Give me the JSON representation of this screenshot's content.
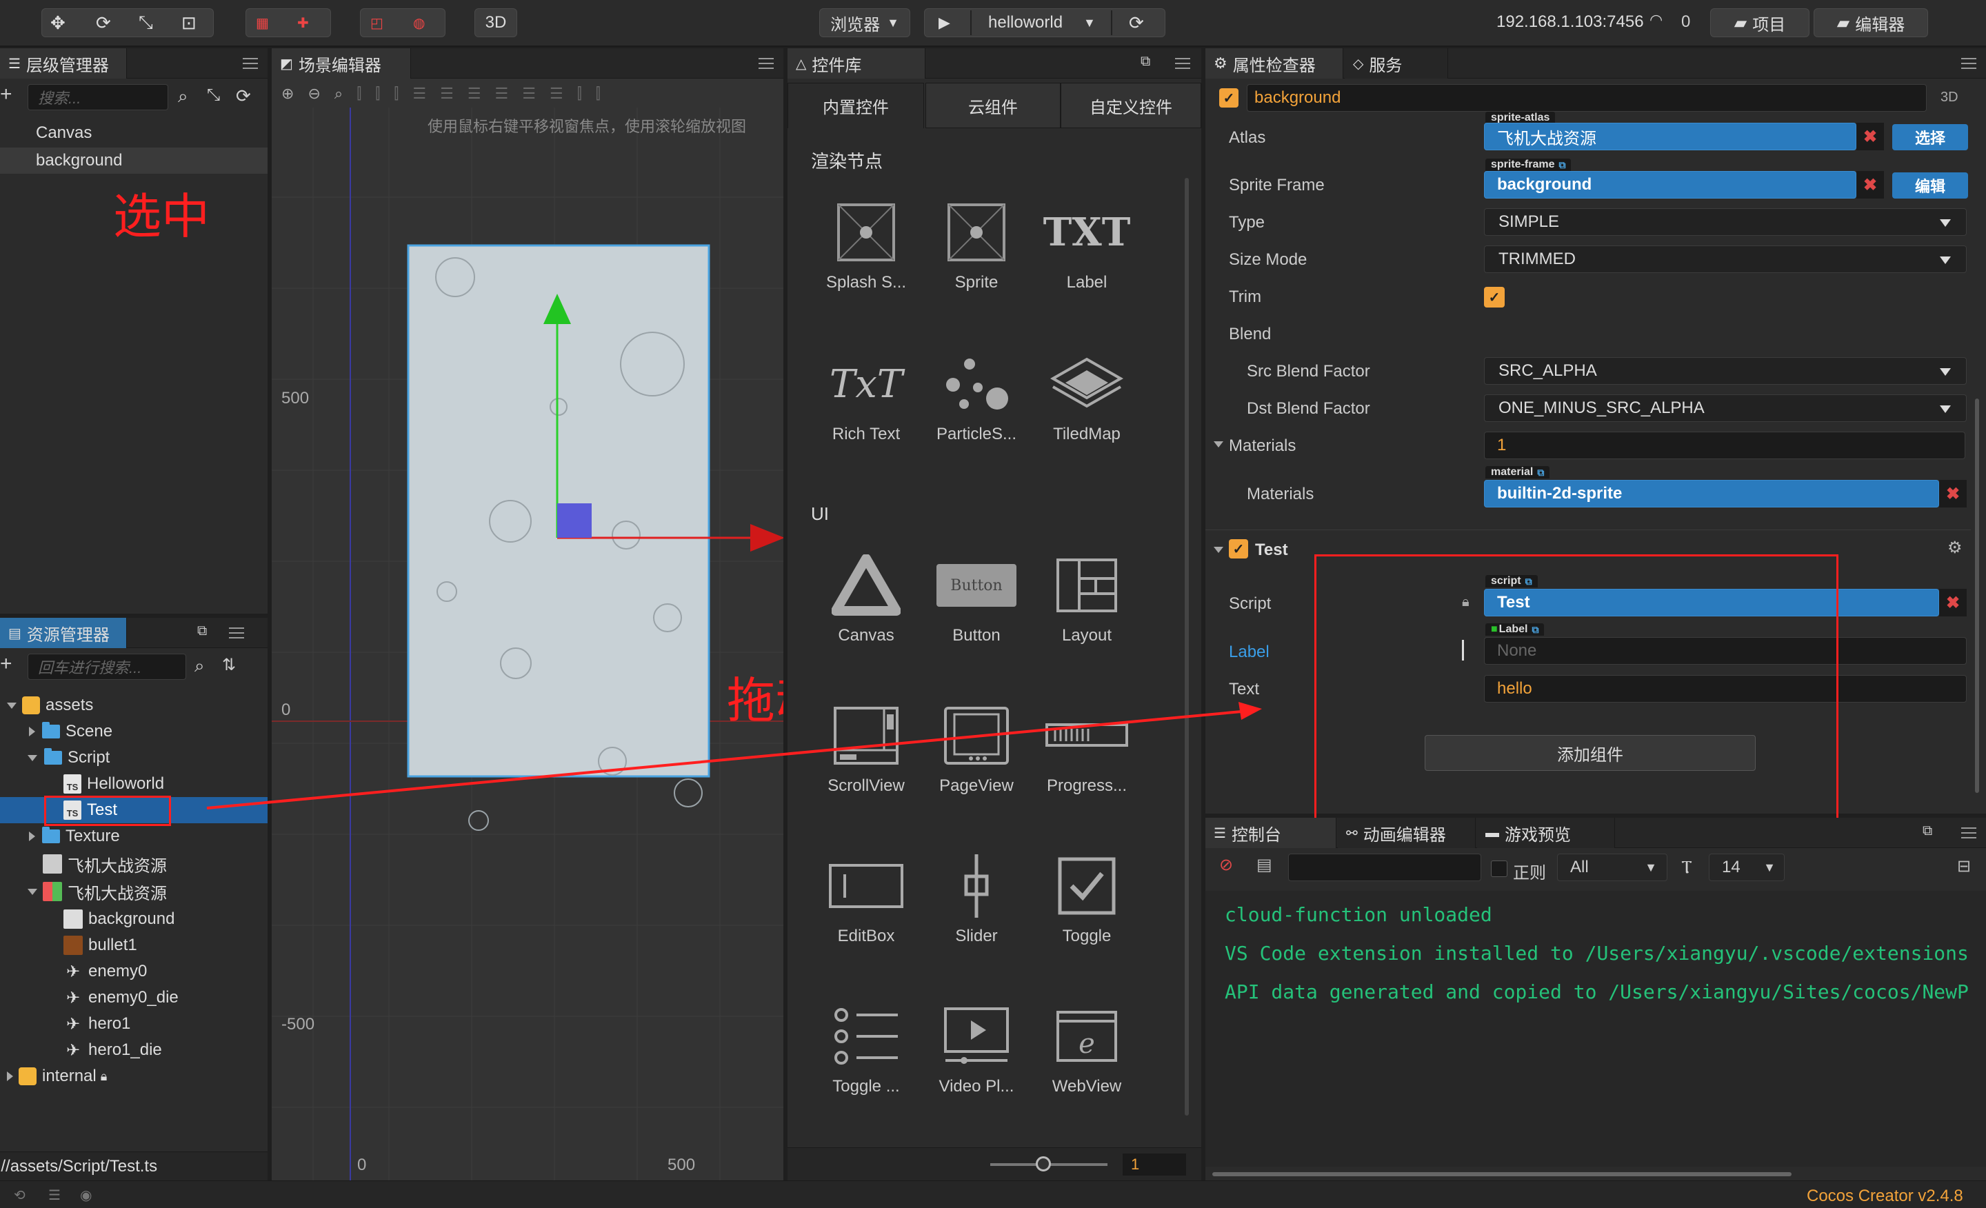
{
  "toolbar": {
    "btn_3d": "3D",
    "browser": "浏览器",
    "scene_select": "helloworld",
    "ip": "192.168.1.103:7456",
    "clients": "0",
    "project": "项目",
    "editor": "编辑器"
  },
  "hierarchy": {
    "title": "层级管理器",
    "search_placeholder": "搜索...",
    "nodes": [
      "Canvas",
      "background"
    ],
    "annotation": "选中"
  },
  "scene": {
    "title": "场景编辑器",
    "hint": "使用鼠标右键平移视窗焦点，使用滚轮缩放视图",
    "ruler_y": [
      "500",
      "0",
      "-500"
    ],
    "ruler_x": [
      "0",
      "500"
    ],
    "annotation": "拖动"
  },
  "library": {
    "title": "控件库",
    "tabs": [
      "内置控件",
      "云组件",
      "自定义控件"
    ],
    "section_render": "渲染节点",
    "section_ui": "UI",
    "render_items": [
      "Splash S...",
      "Sprite",
      "Label",
      "Rich Text",
      "ParticleS...",
      "TiledMap"
    ],
    "ui_items": [
      "Canvas",
      "Button",
      "Layout",
      "ScrollView",
      "PageView",
      "Progress...",
      "EditBox",
      "Slider",
      "Toggle",
      "Toggle ...",
      "Video Pl...",
      "WebView"
    ],
    "icon_txt": "TXT",
    "icon_rich": "TxT",
    "icon_button": "Button",
    "zoom_value": "1"
  },
  "assets": {
    "title": "资源管理器",
    "search_placeholder": "回车进行搜索...",
    "tree": [
      "assets",
      "Scene",
      "Script",
      "Helloworld",
      "Test",
      "Texture",
      "飞机大战资源",
      "飞机大战资源",
      "background",
      "bullet1",
      "enemy0",
      "enemy0_die",
      "hero1",
      "hero1_die",
      "internal"
    ],
    "ts_badge": "TS",
    "path": "db://assets/Script/Test.ts"
  },
  "inspector": {
    "tab1": "属性检查器",
    "tab2": "服务",
    "node_name": "background",
    "btn_3d": "3D",
    "atlas_label": "Atlas",
    "atlas_small": "sprite-atlas",
    "atlas_value": "飞机大战资源",
    "select_btn": "选择",
    "sf_label": "Sprite Frame",
    "sf_small": "sprite-frame",
    "sf_value": "background",
    "edit_btn": "编辑",
    "type_label": "Type",
    "type_value": "SIMPLE",
    "size_label": "Size Mode",
    "size_value": "TRIMMED",
    "trim_label": "Trim",
    "blend_label": "Blend",
    "src_label": "Src Blend Factor",
    "src_value": "SRC_ALPHA",
    "dst_label": "Dst Blend Factor",
    "dst_value": "ONE_MINUS_SRC_ALPHA",
    "mats_label": "Materials",
    "mats_count": "1",
    "mat_label": "Materials",
    "mat_small": "material",
    "mat_value": "builtin-2d-sprite",
    "test_title": "Test",
    "script_label": "Script",
    "script_small": "script",
    "script_value": "Test",
    "label_label": "Label",
    "label_small": "Label",
    "label_value": "None",
    "text_label": "Text",
    "text_value": "hello",
    "add_component": "添加组件"
  },
  "console": {
    "tab1": "控制台",
    "tab2": "动画编辑器",
    "tab3": "游戏预览",
    "regex": "正则",
    "filter": "All",
    "font_size": "14",
    "lines": [
      "cloud-function unloaded",
      "VS Code extension installed to /Users/xiangyu/.vscode/extensions",
      "API data generated and copied to /Users/xiangyu/Sites/cocos/NewP"
    ]
  },
  "status": {
    "version": "Cocos Creator v2.4.8"
  },
  "colors": {
    "accent_blue": "#2a7bbe",
    "annotation_red": "#ff1f1f",
    "console_green": "#25c27a",
    "check_orange": "#f3a33a"
  }
}
